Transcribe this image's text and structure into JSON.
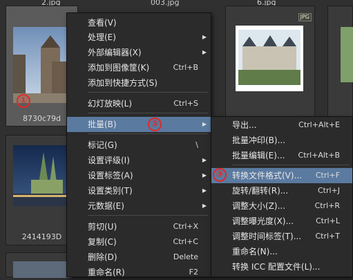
{
  "top_filenames": [
    "2.jpg",
    "003.jpg",
    "6.jpg"
  ],
  "thumbs": {
    "t1": {
      "caption": "8730c79d"
    },
    "t2": {
      "badge": "JPG"
    },
    "t3": {
      "caption": "2414193D"
    }
  },
  "annotations": [
    "①",
    "②",
    "③"
  ],
  "main_menu": [
    {
      "label": "查看(V)",
      "shortcut": "",
      "submenu": false
    },
    {
      "label": "处理(E)",
      "shortcut": "",
      "submenu": true
    },
    {
      "label": "外部编辑器(X)",
      "shortcut": "",
      "submenu": true
    },
    {
      "label": "添加到图像筐(K)",
      "shortcut": "Ctrl+B",
      "submenu": false
    },
    {
      "label": "添加到快捷方式(S)",
      "shortcut": "",
      "submenu": false
    },
    {
      "label": "幻灯放映(L)",
      "shortcut": "Ctrl+S",
      "submenu": false
    },
    {
      "label": "批量(B)",
      "shortcut": "",
      "submenu": true,
      "highlighted": true
    },
    {
      "label": "标记(G)",
      "shortcut": "\\",
      "submenu": false
    },
    {
      "label": "设置评级(I)",
      "shortcut": "",
      "submenu": true
    },
    {
      "label": "设置标签(A)",
      "shortcut": "",
      "submenu": true
    },
    {
      "label": "设置类别(T)",
      "shortcut": "",
      "submenu": true
    },
    {
      "label": "元数据(E)",
      "shortcut": "",
      "submenu": true
    },
    {
      "label": "剪切(U)",
      "shortcut": "Ctrl+X",
      "submenu": false
    },
    {
      "label": "复制(C)",
      "shortcut": "Ctrl+C",
      "submenu": false
    },
    {
      "label": "删除(D)",
      "shortcut": "Delete",
      "submenu": false
    },
    {
      "label": "重命名(R)",
      "shortcut": "F2",
      "submenu": false
    }
  ],
  "batch_menu": [
    {
      "label": "导出...",
      "shortcut": "Ctrl+Alt+E"
    },
    {
      "label": "批量冲印(B)...",
      "shortcut": ""
    },
    {
      "label": "批量编辑(E)...",
      "shortcut": "Ctrl+Alt+B"
    },
    {
      "label": "转换文件格式(V)...",
      "shortcut": "Ctrl+F",
      "highlighted": true
    },
    {
      "label": "旋转/翻转(R)...",
      "shortcut": "Ctrl+J"
    },
    {
      "label": "调整大小(Z)...",
      "shortcut": "Ctrl+R"
    },
    {
      "label": "调整曝光度(X)...",
      "shortcut": "Ctrl+L"
    },
    {
      "label": "调整时间标签(T)...",
      "shortcut": "Ctrl+T"
    },
    {
      "label": "重命名(N)...",
      "shortcut": ""
    },
    {
      "label": "转换 ICC 配置文件(L)...",
      "shortcut": ""
    }
  ]
}
